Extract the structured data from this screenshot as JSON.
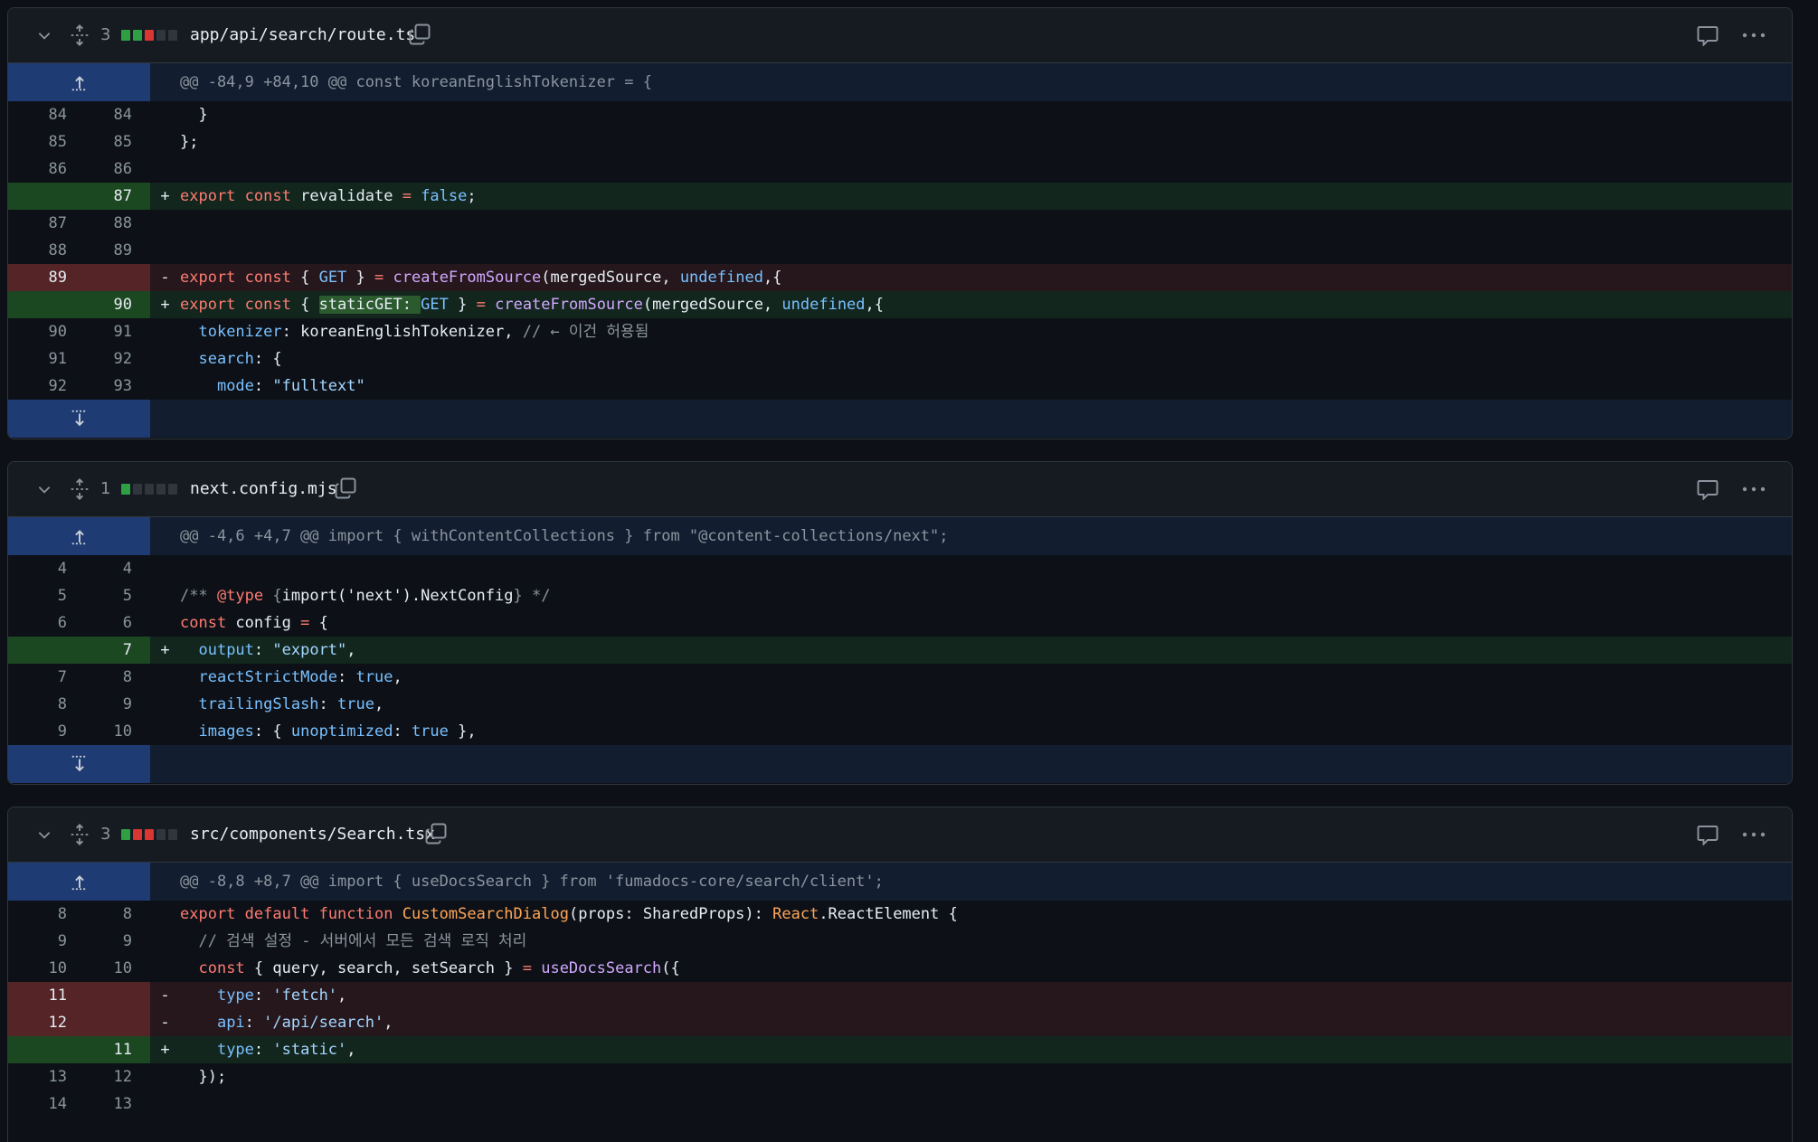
{
  "files": [
    {
      "count": "3",
      "diffstat": [
        "add",
        "add",
        "del",
        "neu",
        "neu"
      ],
      "name": "app/api/search/route.ts",
      "hunk": "@@ -84,9 +84,10 @@ const koreanEnglishTokenizer = {",
      "lines": [
        {
          "type": "ctx",
          "old": "84",
          "new": "84",
          "code": "  }"
        },
        {
          "type": "ctx",
          "old": "85",
          "new": "85",
          "code": "};"
        },
        {
          "type": "ctx",
          "old": "86",
          "new": "86",
          "code": ""
        },
        {
          "type": "add",
          "old": "",
          "new": "87",
          "code": "export const revalidate = false;"
        },
        {
          "type": "ctx",
          "old": "87",
          "new": "88",
          "code": ""
        },
        {
          "type": "ctx",
          "old": "88",
          "new": "89",
          "code": ""
        },
        {
          "type": "del",
          "old": "89",
          "new": "",
          "code": "export const { GET } = createFromSource(mergedSource, undefined,{"
        },
        {
          "type": "add",
          "old": "",
          "new": "90",
          "code": "export const { staticGET: GET } = createFromSource(mergedSource, undefined,{"
        },
        {
          "type": "ctx",
          "old": "90",
          "new": "91",
          "code": "  tokenizer: koreanEnglishTokenizer, // ← 이건 허용됨"
        },
        {
          "type": "ctx",
          "old": "91",
          "new": "92",
          "code": "  search: {"
        },
        {
          "type": "ctx",
          "old": "92",
          "new": "93",
          "code": "    mode: \"fulltext\""
        }
      ]
    },
    {
      "count": "1",
      "diffstat": [
        "add",
        "neu",
        "neu",
        "neu",
        "neu"
      ],
      "name": "next.config.mjs",
      "hunk": "@@ -4,6 +4,7 @@ import { withContentCollections } from \"@content-collections/next\";",
      "lines": [
        {
          "type": "ctx",
          "old": "4",
          "new": "4",
          "code": ""
        },
        {
          "type": "ctx",
          "old": "5",
          "new": "5",
          "code": "/** @type {import('next').NextConfig} */"
        },
        {
          "type": "ctx",
          "old": "6",
          "new": "6",
          "code": "const config = {"
        },
        {
          "type": "add",
          "old": "",
          "new": "7",
          "code": "  output: \"export\","
        },
        {
          "type": "ctx",
          "old": "7",
          "new": "8",
          "code": "  reactStrictMode: true,"
        },
        {
          "type": "ctx",
          "old": "8",
          "new": "9",
          "code": "  trailingSlash: true,"
        },
        {
          "type": "ctx",
          "old": "9",
          "new": "10",
          "code": "  images: { unoptimized: true },"
        }
      ]
    },
    {
      "count": "3",
      "diffstat": [
        "add",
        "del",
        "del",
        "neu",
        "neu"
      ],
      "name": "src/components/Search.tsx",
      "hunk": "@@ -8,8 +8,7 @@ import { useDocsSearch } from 'fumadocs-core/search/client';",
      "lines": [
        {
          "type": "ctx",
          "old": "8",
          "new": "8",
          "code": "export default function CustomSearchDialog(props: SharedProps): React.ReactElement {"
        },
        {
          "type": "ctx",
          "old": "9",
          "new": "9",
          "code": "  // 검색 설정 - 서버에서 모든 검색 로직 처리"
        },
        {
          "type": "ctx",
          "old": "10",
          "new": "10",
          "code": "  const { query, search, setSearch } = useDocsSearch({"
        },
        {
          "type": "del",
          "old": "11",
          "new": "",
          "code": "    type: 'fetch',"
        },
        {
          "type": "del",
          "old": "12",
          "new": "",
          "code": "    api: '/api/search',"
        },
        {
          "type": "add",
          "old": "",
          "new": "11",
          "code": "    type: 'static',"
        },
        {
          "type": "ctx",
          "old": "13",
          "new": "12",
          "code": "  });"
        },
        {
          "type": "ctx",
          "old": "14",
          "new": "13",
          "code": ""
        }
      ]
    }
  ],
  "colors": {
    "add": "#2ea043",
    "del": "#da3633",
    "bg": "#0d1117"
  },
  "icons": {
    "collapse": "chevron-down-icon",
    "expand": "unfold-icon",
    "copy": "copy-icon",
    "comment": "comment-icon",
    "more": "kebab-horizontal-icon"
  }
}
